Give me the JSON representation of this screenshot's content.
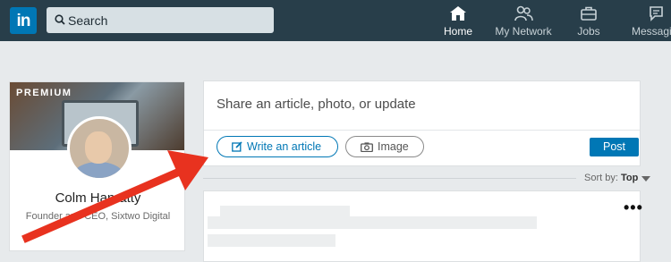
{
  "navbar": {
    "logo_text": "in",
    "search_placeholder": "Search",
    "items": [
      {
        "label": "Home",
        "icon": "home-icon",
        "active": true
      },
      {
        "label": "My Network",
        "icon": "network-icon",
        "active": false
      },
      {
        "label": "Jobs",
        "icon": "briefcase-icon",
        "active": false
      },
      {
        "label": "Messaging",
        "icon": "messaging-icon",
        "active": false
      }
    ]
  },
  "profile": {
    "badge": "PREMIUM",
    "name": "Colm Hanratty",
    "title": "Founder and CEO, Sixtwo Digital"
  },
  "share": {
    "prompt": "Share an article, photo, or update",
    "write_article_label": "Write an article",
    "image_label": "Image",
    "post_label": "Post"
  },
  "feed": {
    "sort_prefix": "Sort by:",
    "sort_value": "Top",
    "more_label": "•••"
  },
  "colors": {
    "nav_bg": "#283e4a",
    "brand_blue": "#0077b5",
    "annotation_red": "#e8321f"
  }
}
